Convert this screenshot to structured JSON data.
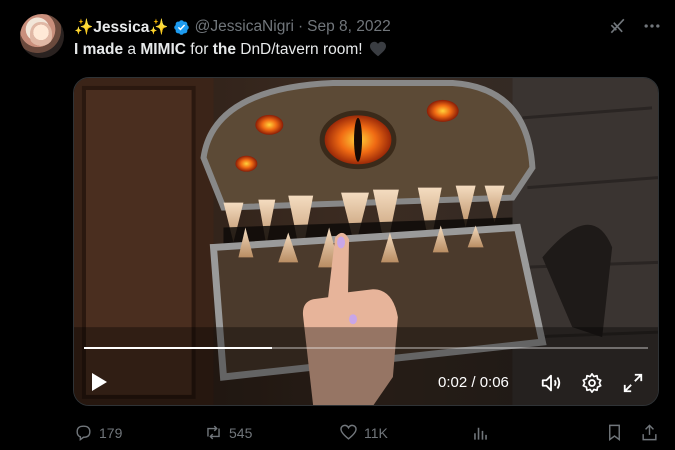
{
  "tweet": {
    "display_name": "✨Jessica✨",
    "handle": "@JessicaNigri",
    "separator": "·",
    "date": "Sep 8, 2022",
    "text": {
      "part1": "I made",
      "part2": " a ",
      "part3": "MIMIC",
      "part4": " for ",
      "part5": "the",
      "part6": " DnD/tavern room! "
    },
    "text_emoji_icon": "black-heart-icon"
  },
  "video": {
    "time_label": "0:02 / 0:06",
    "progress_percent": 33.3
  },
  "actions": {
    "replies": "179",
    "reposts": "545",
    "likes": "11K",
    "views": ""
  },
  "colors": {
    "background": "#000000",
    "text_primary": "#e7e9ea",
    "text_secondary": "#71767b",
    "verified_blue": "#1d9bf0"
  }
}
